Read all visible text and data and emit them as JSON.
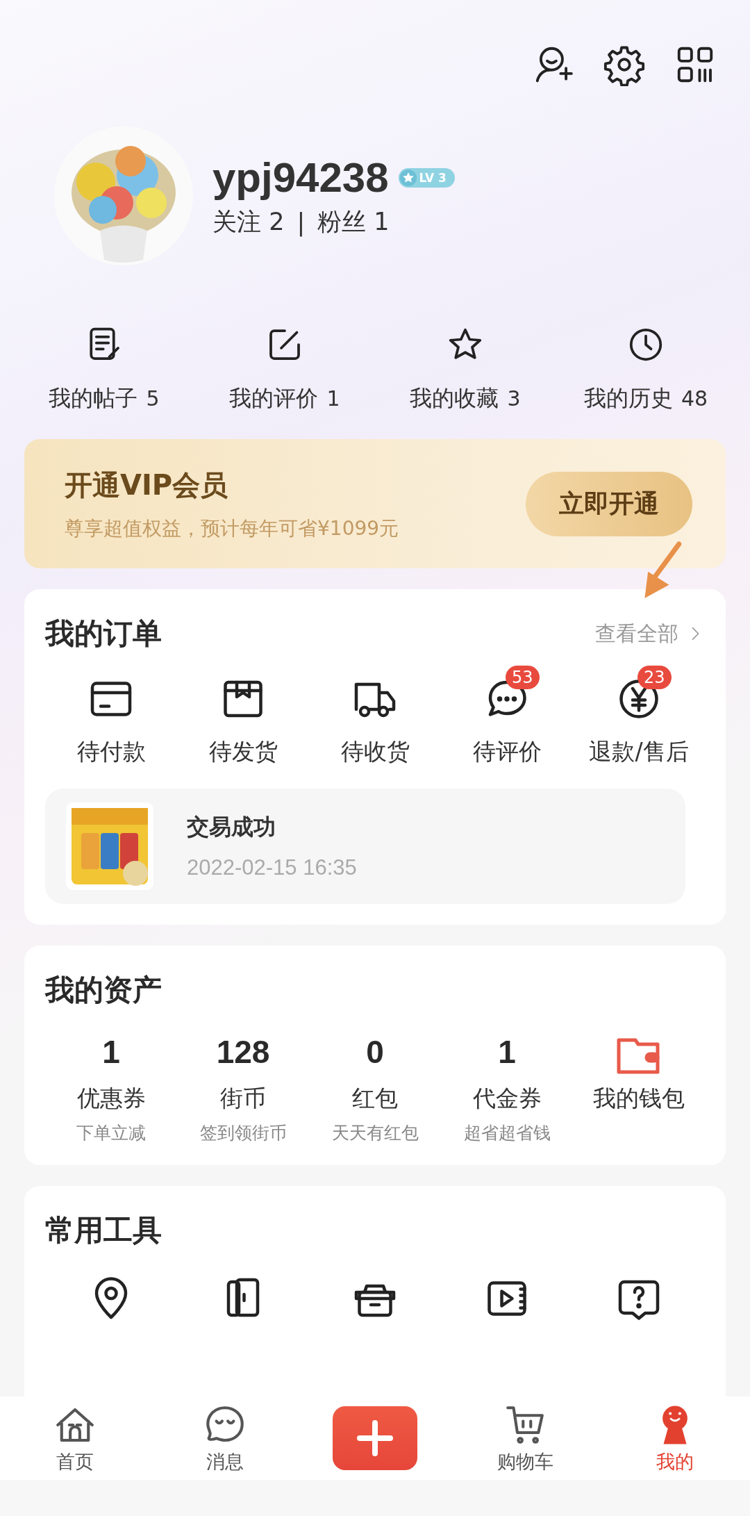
{
  "profile": {
    "username": "ypj94238",
    "level_badge": "LV 3",
    "following": "关注 2",
    "separator": "|",
    "followers": "粉丝 1"
  },
  "shortcuts": [
    {
      "label": "我的帖子",
      "count": "5"
    },
    {
      "label": "我的评价",
      "count": "1"
    },
    {
      "label": "我的收藏",
      "count": "3"
    },
    {
      "label": "我的历史",
      "count": "48"
    }
  ],
  "vip_banner": {
    "title": "开通VIP会员",
    "subtitle": "尊享超值权益，预计每年可省¥1099元",
    "button": "立即开通"
  },
  "orders": {
    "title": "我的订单",
    "view_all": "查看全部",
    "items": [
      {
        "label": "待付款"
      },
      {
        "label": "待发货"
      },
      {
        "label": "待收货"
      },
      {
        "label": "待评价",
        "badge": "53"
      },
      {
        "label": "退款/售后",
        "badge": "23"
      }
    ],
    "latest": {
      "status": "交易成功",
      "time": "2022-02-15 16:35"
    }
  },
  "assets": {
    "title": "我的资产",
    "items": [
      {
        "kind": "stat",
        "value": "1",
        "label": "优惠券",
        "note": "下单立减"
      },
      {
        "kind": "stat",
        "value": "128",
        "label": "街币",
        "note": "签到领街币"
      },
      {
        "kind": "stat",
        "value": "0",
        "label": "红包",
        "note": "天天有红包"
      },
      {
        "kind": "stat",
        "value": "1",
        "label": "代金券",
        "note": "超省超省钱"
      },
      {
        "kind": "wallet",
        "label": "我的钱包"
      }
    ]
  },
  "tools": {
    "title": "常用工具"
  },
  "nav": [
    {
      "kind": "tab",
      "label": "首页",
      "selected": false
    },
    {
      "kind": "tab",
      "label": "消息",
      "selected": false
    },
    {
      "kind": "add"
    },
    {
      "kind": "tab",
      "label": "购物车",
      "selected": false
    },
    {
      "kind": "tab",
      "label": "我的",
      "selected": true
    }
  ]
}
